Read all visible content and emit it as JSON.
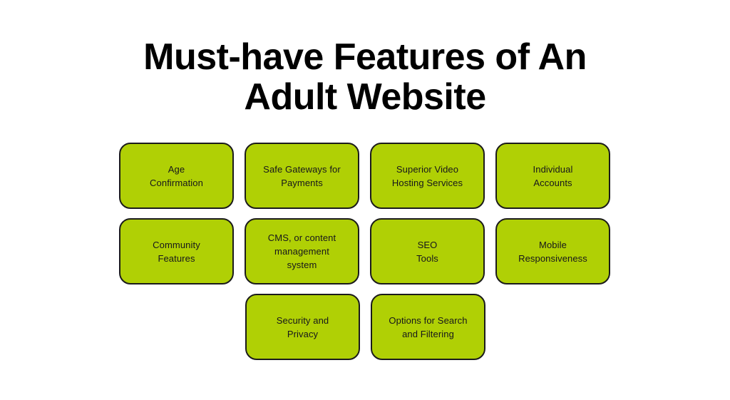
{
  "page": {
    "background_color": "#ffffff",
    "title": "Must-have Features of An\nAdult Website"
  },
  "theme": {
    "card_fill": "#b0d005",
    "card_border": "#1b1b1b",
    "title_color": "#000000",
    "card_text_color": "#16161c"
  },
  "grid": {
    "rows": [
      {
        "cards": [
          {
            "label": "Age\nConfirmation"
          },
          {
            "label": "Safe Gateways for\nPayments"
          },
          {
            "label": "Superior Video\nHosting Services"
          },
          {
            "label": "Individual\nAccounts"
          }
        ]
      },
      {
        "cards": [
          {
            "label": "Community\nFeatures"
          },
          {
            "label": "CMS, or content\nmanagement\nsystem"
          },
          {
            "label": "SEO\nTools"
          },
          {
            "label": "Mobile\nResponsiveness"
          }
        ]
      },
      {
        "offset": true,
        "cards": [
          {
            "label": "Security and\nPrivacy"
          },
          {
            "label": "Options for Search\nand Filtering"
          }
        ]
      }
    ]
  }
}
